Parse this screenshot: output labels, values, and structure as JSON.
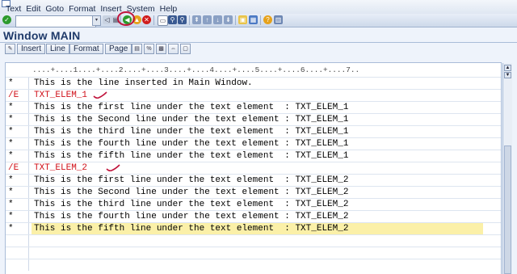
{
  "menubar": {
    "items": [
      "Text",
      "Edit",
      "Goto",
      "Format",
      "Insert",
      "System",
      "Help"
    ]
  },
  "toolbar": {
    "command_value": "",
    "icons": [
      "enter-icon",
      "save-icon",
      "back-icon",
      "exit-icon",
      "cancel-icon",
      "print-icon",
      "find-icon",
      "find-next-icon",
      "first-page-icon",
      "prev-page-icon",
      "next-page-icon",
      "last-page-icon",
      "create-session-icon",
      "shortcut-icon",
      "help-icon",
      "layout-icon"
    ]
  },
  "page": {
    "title": "Window MAIN"
  },
  "app_toolbar": {
    "buttons": [
      "Insert",
      "Line",
      "Format",
      "Page"
    ]
  },
  "editor": {
    "ruler": "....+....1....+....2....+....3....+....4....+....5....+....6....+....7..",
    "rows": [
      {
        "fmt": "*",
        "text": "This is the line inserted in Main Window.",
        "kind": "normal"
      },
      {
        "fmt": "/E",
        "text": "TXT_ELEM_1",
        "kind": "elem"
      },
      {
        "fmt": "*",
        "text": "This is the first line under the text element  : TXT_ELEM_1",
        "kind": "normal"
      },
      {
        "fmt": "*",
        "text": "This is the Second line under the text element : TXT_ELEM_1",
        "kind": "normal"
      },
      {
        "fmt": "*",
        "text": "This is the third line under the text element  : TXT_ELEM_1",
        "kind": "normal"
      },
      {
        "fmt": "*",
        "text": "This is the fourth line under the text element : TXT_ELEM_1",
        "kind": "normal"
      },
      {
        "fmt": "*",
        "text": "This is the fifth line under the text element  : TXT_ELEM_1",
        "kind": "normal"
      },
      {
        "fmt": "/E",
        "text": "TXT_ELEM_2",
        "kind": "elem"
      },
      {
        "fmt": "*",
        "text": "This is the first line under the text element  : TXT_ELEM_2",
        "kind": "normal"
      },
      {
        "fmt": "*",
        "text": "This is the Second line under the text element : TXT_ELEM_2",
        "kind": "normal"
      },
      {
        "fmt": "*",
        "text": "This is the third line under the text element  : TXT_ELEM_2",
        "kind": "normal"
      },
      {
        "fmt": "*",
        "text": "This is the fourth line under the text element : TXT_ELEM_2",
        "kind": "normal"
      },
      {
        "fmt": "*",
        "text": "This is the fifth line under the text element  : TXT_ELEM_2",
        "kind": "highlight"
      },
      {
        "fmt": "",
        "text": "",
        "kind": "empty"
      },
      {
        "fmt": "",
        "text": "",
        "kind": "empty"
      },
      {
        "fmt": "",
        "text": "",
        "kind": "empty"
      }
    ]
  },
  "colors": {
    "title": "#1f3a6a",
    "element_red": "#d0111a",
    "highlight": "#fbf0a8",
    "annotation": "#c0143c"
  }
}
